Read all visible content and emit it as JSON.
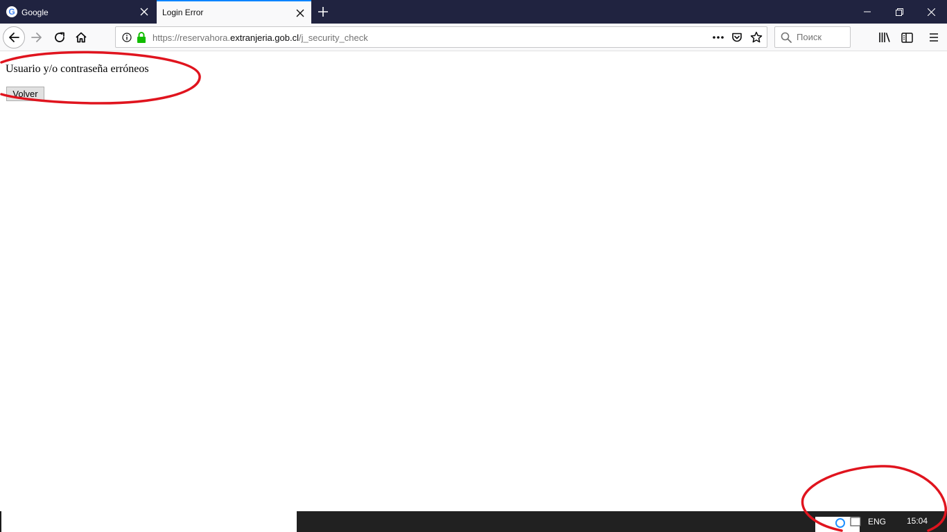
{
  "tabs": [
    {
      "title": "Google",
      "favicon_letter": "G",
      "active": false
    },
    {
      "title": "Login Error",
      "active": true
    }
  ],
  "window_controls": [
    "minimize-icon",
    "restore-icon",
    "close-icon"
  ],
  "navbar": {
    "url_prefix": "https://reservahora.",
    "url_domain": "extranjeria.gob.cl",
    "url_path": "/j_security_check",
    "icons": [
      "back-arrow-icon",
      "forward-arrow-icon",
      "reload-icon",
      "home-icon",
      "info-icon",
      "lock-icon",
      "page-actions-icon",
      "pocket-icon",
      "star-icon",
      "library-icon",
      "sidebar-icon",
      "hamburger-menu-icon"
    ]
  },
  "search": {
    "placeholder": "Поиск"
  },
  "page": {
    "message": "Usuario y/o contraseña erróneos",
    "button_label": "Volver"
  },
  "taskbar": {
    "language": "ENG",
    "time": "15:04"
  },
  "colors": {
    "titlebar": "#202340",
    "toolbar": "#f9f9fa",
    "active_tab_accent": "#0a84ff",
    "lock_green": "#12bc00",
    "annotation_red": "#e0141e",
    "taskbar": "#212121"
  }
}
